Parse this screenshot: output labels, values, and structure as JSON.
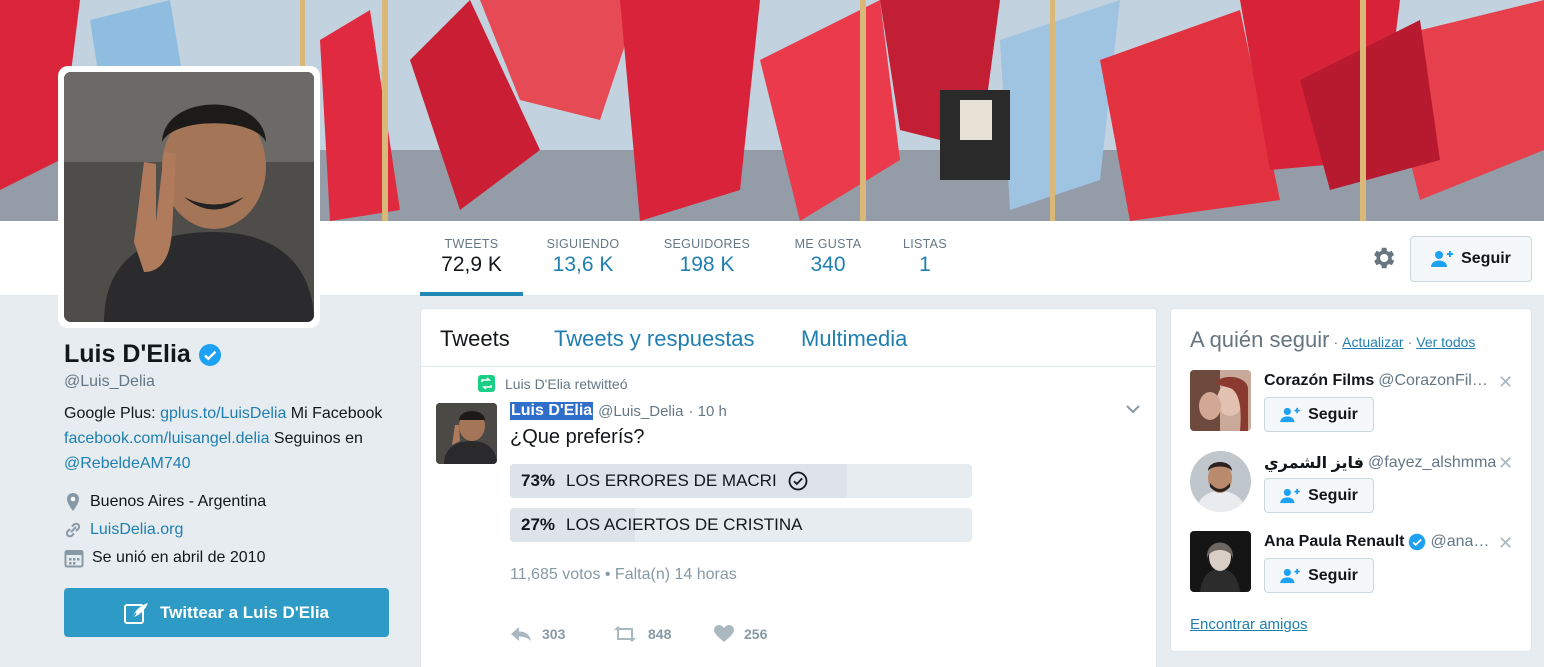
{
  "colors": {
    "accent": "#1f88b4",
    "link": "#1f7fb0",
    "verified": "#1da1f2",
    "flag_red": "#d9243a",
    "flag_blue": "#8fbde0"
  },
  "nav": {
    "stats": [
      {
        "label": "TWEETS",
        "value": "72,9 K",
        "active": true
      },
      {
        "label": "SIGUIENDO",
        "value": "13,6 K",
        "active": false
      },
      {
        "label": "SEGUIDORES",
        "value": "198 K",
        "active": false
      },
      {
        "label": "ME GUSTA",
        "value": "340",
        "active": false
      },
      {
        "label": "LISTAS",
        "value": "1",
        "active": false
      }
    ],
    "gear_icon": "gear-icon",
    "follow_label": "Seguir"
  },
  "profile": {
    "name": "Luis D'Elia",
    "handle": "@Luis_Delia",
    "bio": {
      "p1": "Google Plus: ",
      "link1": "gplus.to/LuisDelia",
      "p2": " Mi Facebook ",
      "link2": "facebook.com/luisangel.delia",
      "p3": " Seguinos en ",
      "link3": "@RebeldeAM740"
    },
    "location": "Buenos Aires - Argentina",
    "website": "LuisDelia.org",
    "joined": "Se unió en abril de 2010",
    "tweet_to_label": "Twittear a Luis D'Elia"
  },
  "timeline": {
    "tabs": [
      "Tweets",
      "Tweets y respuestas",
      "Multimedia"
    ],
    "tweet": {
      "retweeted_by": "Luis D'Elia retwitteó",
      "author_name": "Luis D'Elia",
      "author_handle": "@Luis_Delia",
      "time": "· 10 h",
      "text": "¿Que preferís?",
      "poll": [
        {
          "percent": "73%",
          "fraction": 0.73,
          "label": "LOS ERRORES DE MACRI",
          "winner": true
        },
        {
          "percent": "27%",
          "fraction": 0.27,
          "label": "LOS ACIERTOS DE CRISTINA",
          "winner": false
        }
      ],
      "poll_stats": "11,685 votos • Falta(n) 14 horas",
      "replies": "303",
      "retweets": "848",
      "likes": "256"
    }
  },
  "who_to_follow": {
    "title": "A quién seguir",
    "dot": "·",
    "refresh": "Actualizar",
    "view_all": "Ver todos",
    "suggestions": [
      {
        "name": "Corazón Films",
        "handle": "@CorazonFil…",
        "verified": false,
        "button": "Seguir"
      },
      {
        "name": "فايز الشمري",
        "handle": "@fayez_alshmmari",
        "verified": false,
        "button": "Seguir"
      },
      {
        "name": "Ana Paula Renault",
        "handle": "@ana…",
        "verified": true,
        "button": "Seguir"
      }
    ],
    "dismiss": "✕",
    "find_friends": "Encontrar amigos"
  }
}
